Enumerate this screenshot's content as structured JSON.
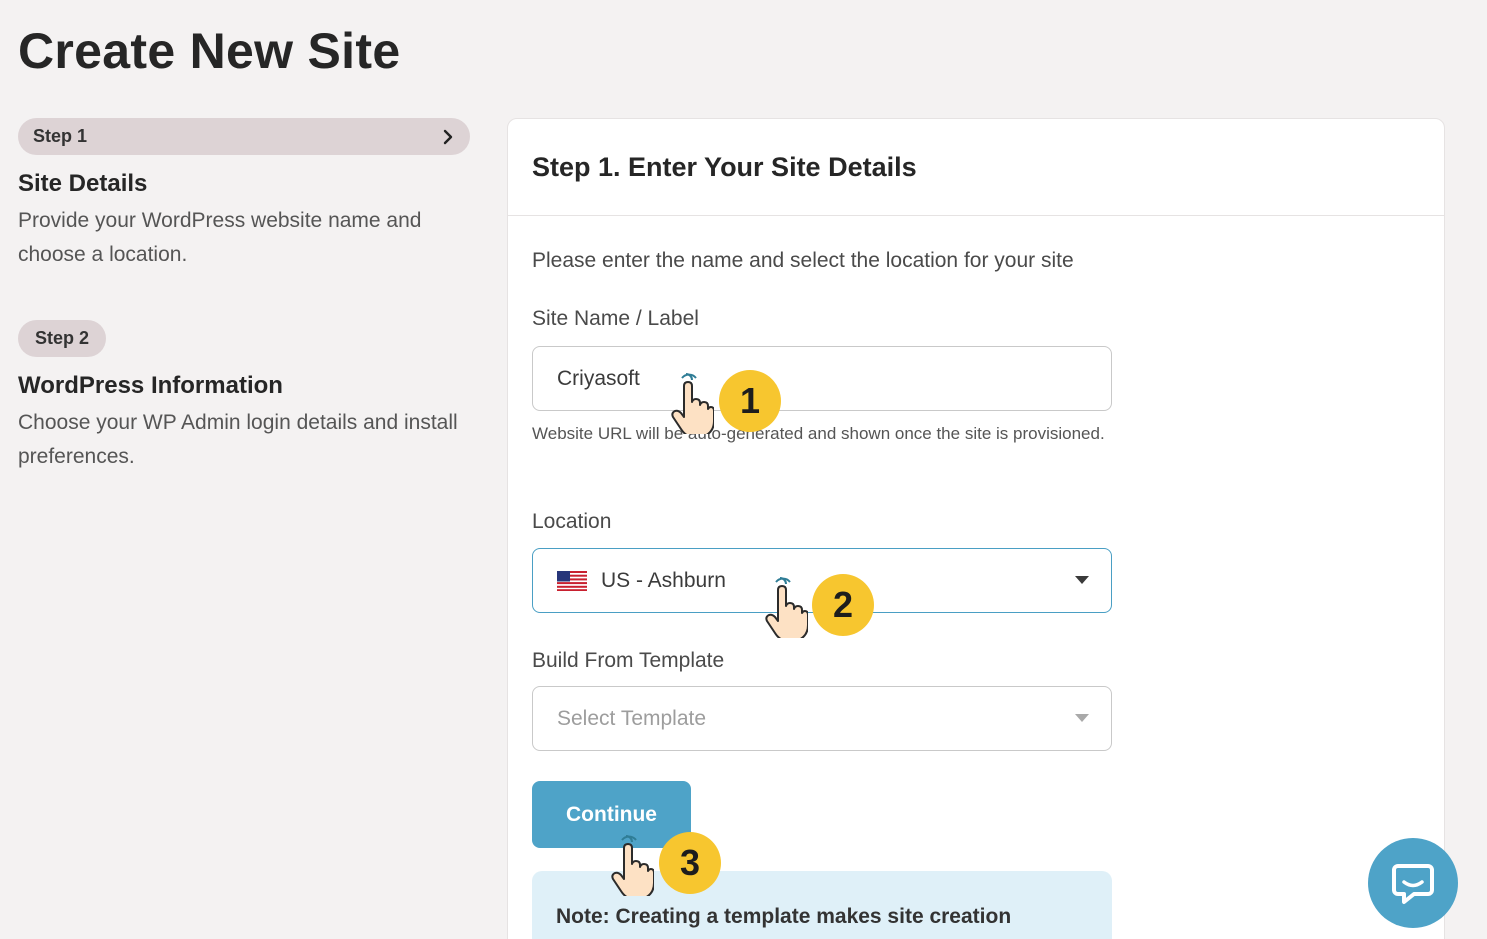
{
  "page": {
    "title": "Create New Site"
  },
  "steps": [
    {
      "pill": "Step 1",
      "title": "Site Details",
      "description": "Provide your WordPress website name and choose a location.",
      "active": true
    },
    {
      "pill": "Step 2",
      "title": "WordPress Information",
      "description": "Choose your WP Admin login details and install preferences.",
      "active": false
    }
  ],
  "card": {
    "title": "Step 1. Enter Your Site Details",
    "intro": "Please enter the name and select the location for your site",
    "site_name": {
      "label": "Site Name / Label",
      "value": "Criyasoft",
      "help": "Website URL will be auto-generated and shown once the site is provisioned."
    },
    "location": {
      "label": "Location",
      "value": "US - Ashburn",
      "flag_icon": "us-flag-icon"
    },
    "template": {
      "label": "Build From Template",
      "placeholder": "Select Template"
    },
    "continue_label": "Continue",
    "note": "Note: Creating a template makes site creation"
  },
  "annotations": [
    "1",
    "2",
    "3"
  ],
  "colors": {
    "accent": "#4ea3c8",
    "badge": "#f7c62f",
    "step_pill": "#ddd3d5",
    "note_bg": "#dff0f8"
  }
}
